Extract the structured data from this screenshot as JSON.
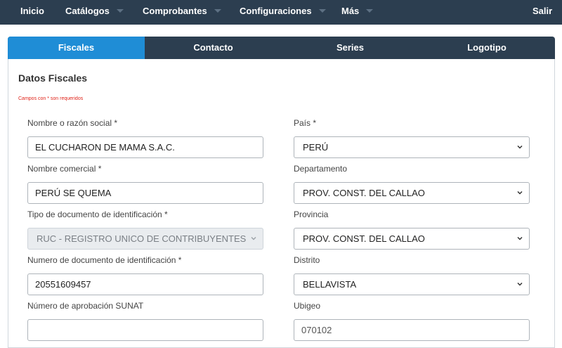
{
  "nav": {
    "items": [
      {
        "label": "Inicio"
      },
      {
        "label": "Catálogos"
      },
      {
        "label": "Comprobantes"
      },
      {
        "label": "Configuraciones"
      },
      {
        "label": "Más"
      }
    ],
    "logout": "Salir"
  },
  "tabs": [
    {
      "label": "Fiscales",
      "active": true
    },
    {
      "label": "Contacto"
    },
    {
      "label": "Series"
    },
    {
      "label": "Logotipo"
    }
  ],
  "form": {
    "title": "Datos Fiscales",
    "required_note": "Campos con * son requeridos",
    "razon_social": {
      "label": "Nombre o razón social *",
      "value": "EL CUCHARON DE MAMA S.A.C."
    },
    "nombre_comercial": {
      "label": "Nombre comercial *",
      "value": "PERÚ SE QUEMA"
    },
    "tipo_documento": {
      "label": "Tipo de documento de identificación *",
      "value": "RUC - REGISTRO UNICO DE CONTRIBUYENTES",
      "disabled": true
    },
    "numero_documento": {
      "label": "Numero de documento de identificación *",
      "value": "20551609457"
    },
    "aprobacion_sunat": {
      "label": "Número de aprobación SUNAT",
      "value": ""
    },
    "pais": {
      "label": "País *",
      "value": "PERÚ"
    },
    "departamento": {
      "label": "Departamento",
      "value": "PROV. CONST. DEL CALLAO"
    },
    "provincia": {
      "label": "Provincia",
      "value": "PROV. CONST. DEL CALLAO"
    },
    "distrito": {
      "label": "Distrito",
      "value": "BELLAVISTA"
    },
    "ubigeo": {
      "label": "Ubigeo",
      "value": "070102"
    }
  },
  "colors": {
    "nav_bg": "#2c3e50",
    "tab_active": "#1f8dd6",
    "required": "#e0251b"
  }
}
